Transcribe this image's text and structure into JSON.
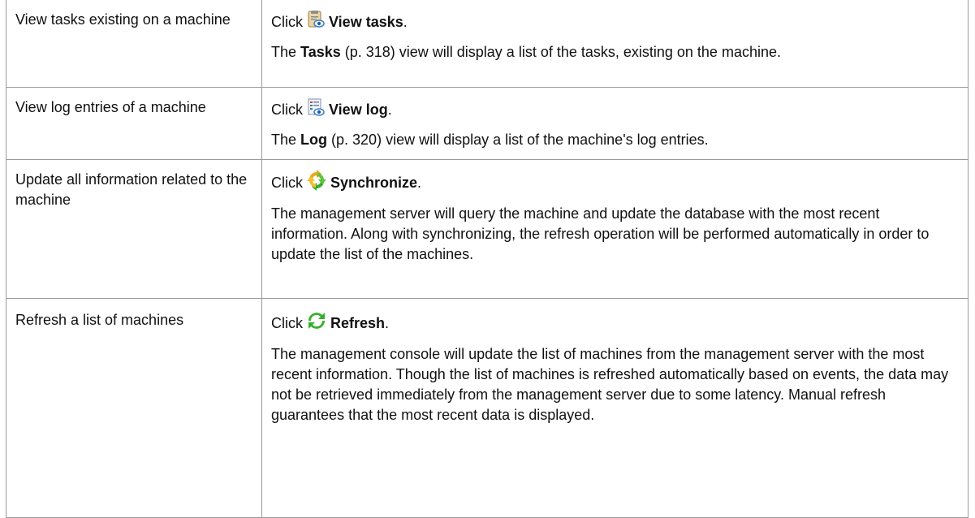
{
  "rows": [
    {
      "action": "View tasks existing on a machine",
      "click_prefix": "Click",
      "icon": "view-tasks-icon",
      "command": "View tasks",
      "click_suffix": ".",
      "desc_prefix": "The ",
      "desc_bold": "Tasks",
      "desc_rest": " (p. 318) view will display a list of the tasks, existing on the machine."
    },
    {
      "action": "View log entries of a machine",
      "click_prefix": "Click",
      "icon": "view-log-icon",
      "command": "View log",
      "click_suffix": ".",
      "desc_prefix": "The ",
      "desc_bold": "Log",
      "desc_rest": " (p. 320) view will display a list of the machine's log entries."
    },
    {
      "action": "Update all information related to the machine",
      "click_prefix": "Click",
      "icon": "synchronize-icon",
      "command": "Synchronize",
      "click_suffix": ".",
      "desc": "The management server will query the machine and update the database with the most recent information. Along with synchronizing, the refresh operation will be performed automatically in order to update the list of the machines."
    },
    {
      "action": "Refresh a list of machines",
      "click_prefix": "Click",
      "icon": "refresh-icon",
      "command": "Refresh",
      "click_suffix": ".",
      "desc": "The management console will update the list of machines from the management server with the most recent information. Though the list of machines is refreshed automatically based on events, the data may not be retrieved immediately from the management server due to some latency. Manual refresh guarantees that the most recent data is displayed."
    }
  ]
}
